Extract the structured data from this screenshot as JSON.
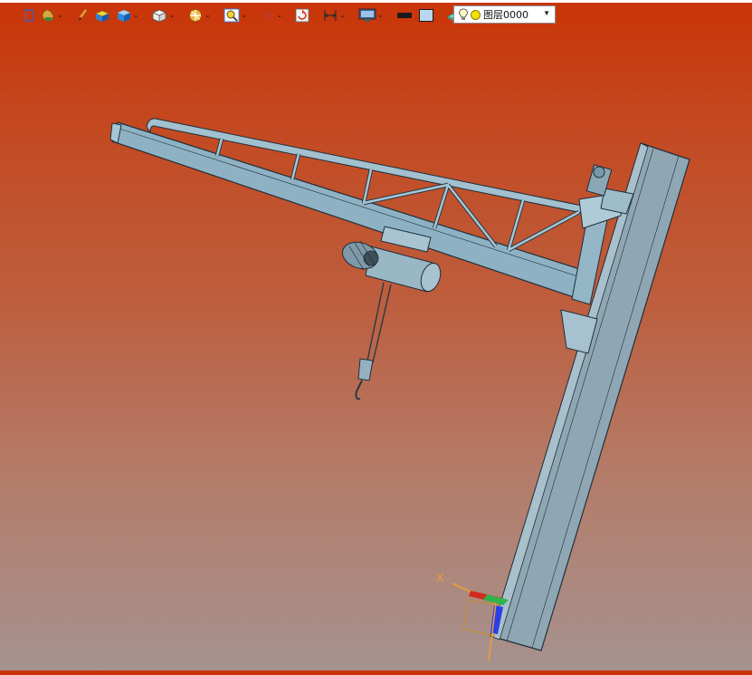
{
  "app": {
    "accent_background_top": "#c93407",
    "accent_background_bottom": "#a6928f"
  },
  "toolbar": {
    "buttons": [
      {
        "icon": "exit-icon",
        "has_dropdown": false
      },
      {
        "icon": "hand-tool-icon",
        "has_dropdown": true
      },
      {
        "icon": "brush-icon",
        "has_dropdown": false
      },
      {
        "icon": "shaded-box-icon",
        "has_dropdown": false
      },
      {
        "icon": "blue-cube-icon",
        "has_dropdown": true
      },
      {
        "icon": "wireframe-cube-icon",
        "has_dropdown": true
      },
      {
        "icon": "section-view-icon",
        "has_dropdown": true
      },
      {
        "icon": "zoom-icon",
        "has_dropdown": true
      },
      {
        "icon": "snap-point-icon",
        "has_dropdown": true
      },
      {
        "icon": "refresh-view-icon",
        "has_dropdown": false
      },
      {
        "icon": "dimension-icon",
        "has_dropdown": true
      },
      {
        "icon": "display-settings-icon",
        "has_dropdown": true
      },
      {
        "icon": "line-color-icon",
        "has_dropdown": false
      },
      {
        "icon": "fill-color-icon",
        "has_dropdown": false
      },
      {
        "icon": "layer-plane-icon",
        "has_dropdown": true
      }
    ],
    "layer": {
      "name": "图层0000",
      "light_icon": "lightbulb-icon",
      "color_indicator": "#f2e100"
    }
  },
  "viewport": {
    "model": "jib-crane-model",
    "triad": {
      "x_label": "X",
      "x_color": "#f0a030",
      "y_color": "#2fb34a",
      "z_color": "#2b3fe8"
    }
  }
}
